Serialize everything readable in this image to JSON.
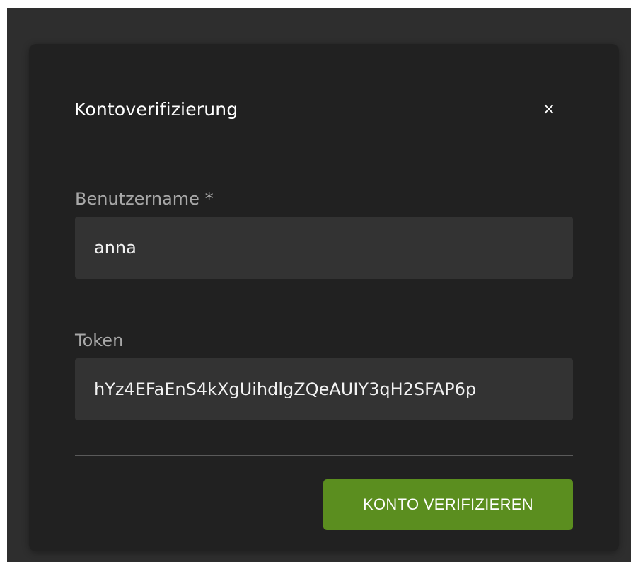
{
  "dialog": {
    "title": "Kontoverifizierung",
    "close_label": "×"
  },
  "form": {
    "username": {
      "label": "Benutzername *",
      "value": "anna"
    },
    "token": {
      "label": "Token",
      "value": "hYz4EFaEnS4kXgUihdlgZQeAUIY3qH2SFAP6p"
    },
    "submit_label": "KONTO VERIFIZIEREN"
  },
  "colors": {
    "accent": "#5b8e1f",
    "dialog_background": "#212121",
    "input_background": "#333333",
    "backdrop": "#2e2e2e"
  }
}
